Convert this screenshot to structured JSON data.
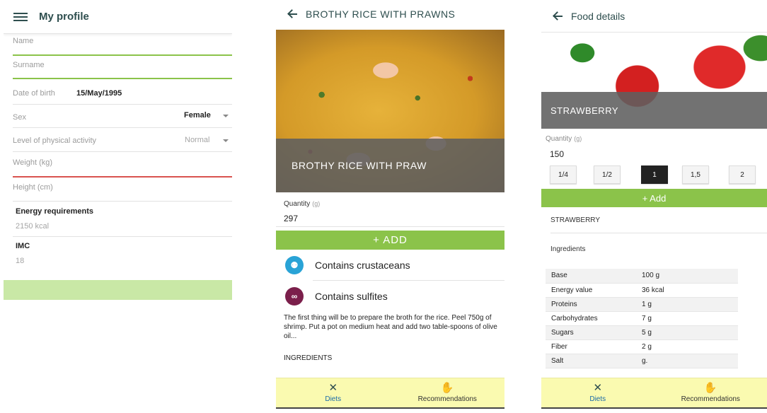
{
  "profile": {
    "title": "My profile",
    "name_label": "Name",
    "surname_label": "Surname",
    "dob_label": "Date of birth",
    "dob_value": "15/May/1995",
    "sex_label": "Sex",
    "sex_value": "Female",
    "activity_label": "Level of physical activity",
    "activity_value": "Normal",
    "weight_label": "Weight (kg)",
    "height_label": "Height (cm)",
    "energy_label": "Energy requirements",
    "energy_value": "2150 kcal",
    "imc_label": "IMC",
    "imc_value": "18",
    "colors": {
      "name_line": "#8bc34a",
      "weight_line": "#d9534f",
      "save_bar": "#c9e8a6"
    }
  },
  "recipe": {
    "title": "BROTHY RICE WITH PRAWNS",
    "hero_caption": "BROTHY RICE WITH PRAW",
    "quantity_label": "Quantity",
    "quantity_unit": "(g)",
    "quantity_value": "297",
    "add_button": "+  ADD",
    "allergens": [
      {
        "icon": "crustacean-icon",
        "label": "Contains crustaceans",
        "color": "#29a3d6"
      },
      {
        "icon": "sulfite-icon",
        "label": "Contains  sulfites",
        "color": "#7b1f4b"
      }
    ],
    "description": "The first thing will be to prepare the broth for the rice. Peel 750g of shrimp. Put a pot on medium heat and add two table-spoons of olive oil...",
    "ingredients_title": "INGREDIENTS"
  },
  "food": {
    "title": "Food details",
    "hero_caption": "STRAWBERRY",
    "quantity_label": "Quantity",
    "quantity_unit": "(g)",
    "quantity_value": "150",
    "fractions": [
      {
        "label": "1/4",
        "active": false
      },
      {
        "label": "1/2",
        "active": false
      },
      {
        "label": "1",
        "active": true
      },
      {
        "label": "1,5",
        "active": false
      },
      {
        "label": "2",
        "active": false
      }
    ],
    "add_button": "+ Add",
    "food_name": "STRAWBERRY",
    "ingredients_label": "Ingredients",
    "nutrition": [
      {
        "name": "Base",
        "value": "100 g"
      },
      {
        "name": "Energy value",
        "value": "36 kcal"
      },
      {
        "name": "Proteins",
        "value": "1 g"
      },
      {
        "name": "Carbohydrates",
        "value": "7 g"
      },
      {
        "name": "Sugars",
        "value": "5 g"
      },
      {
        "name": "Fiber",
        "value": "2 g"
      },
      {
        "name": "Salt",
        "value": "g."
      }
    ]
  },
  "nav": {
    "diets_label": "Diets",
    "recommendations_label": "Recommendations",
    "diets_icon": "cutlery-icon",
    "recommendations_icon": "hand-icon",
    "active_color": "#1a6aa8"
  }
}
